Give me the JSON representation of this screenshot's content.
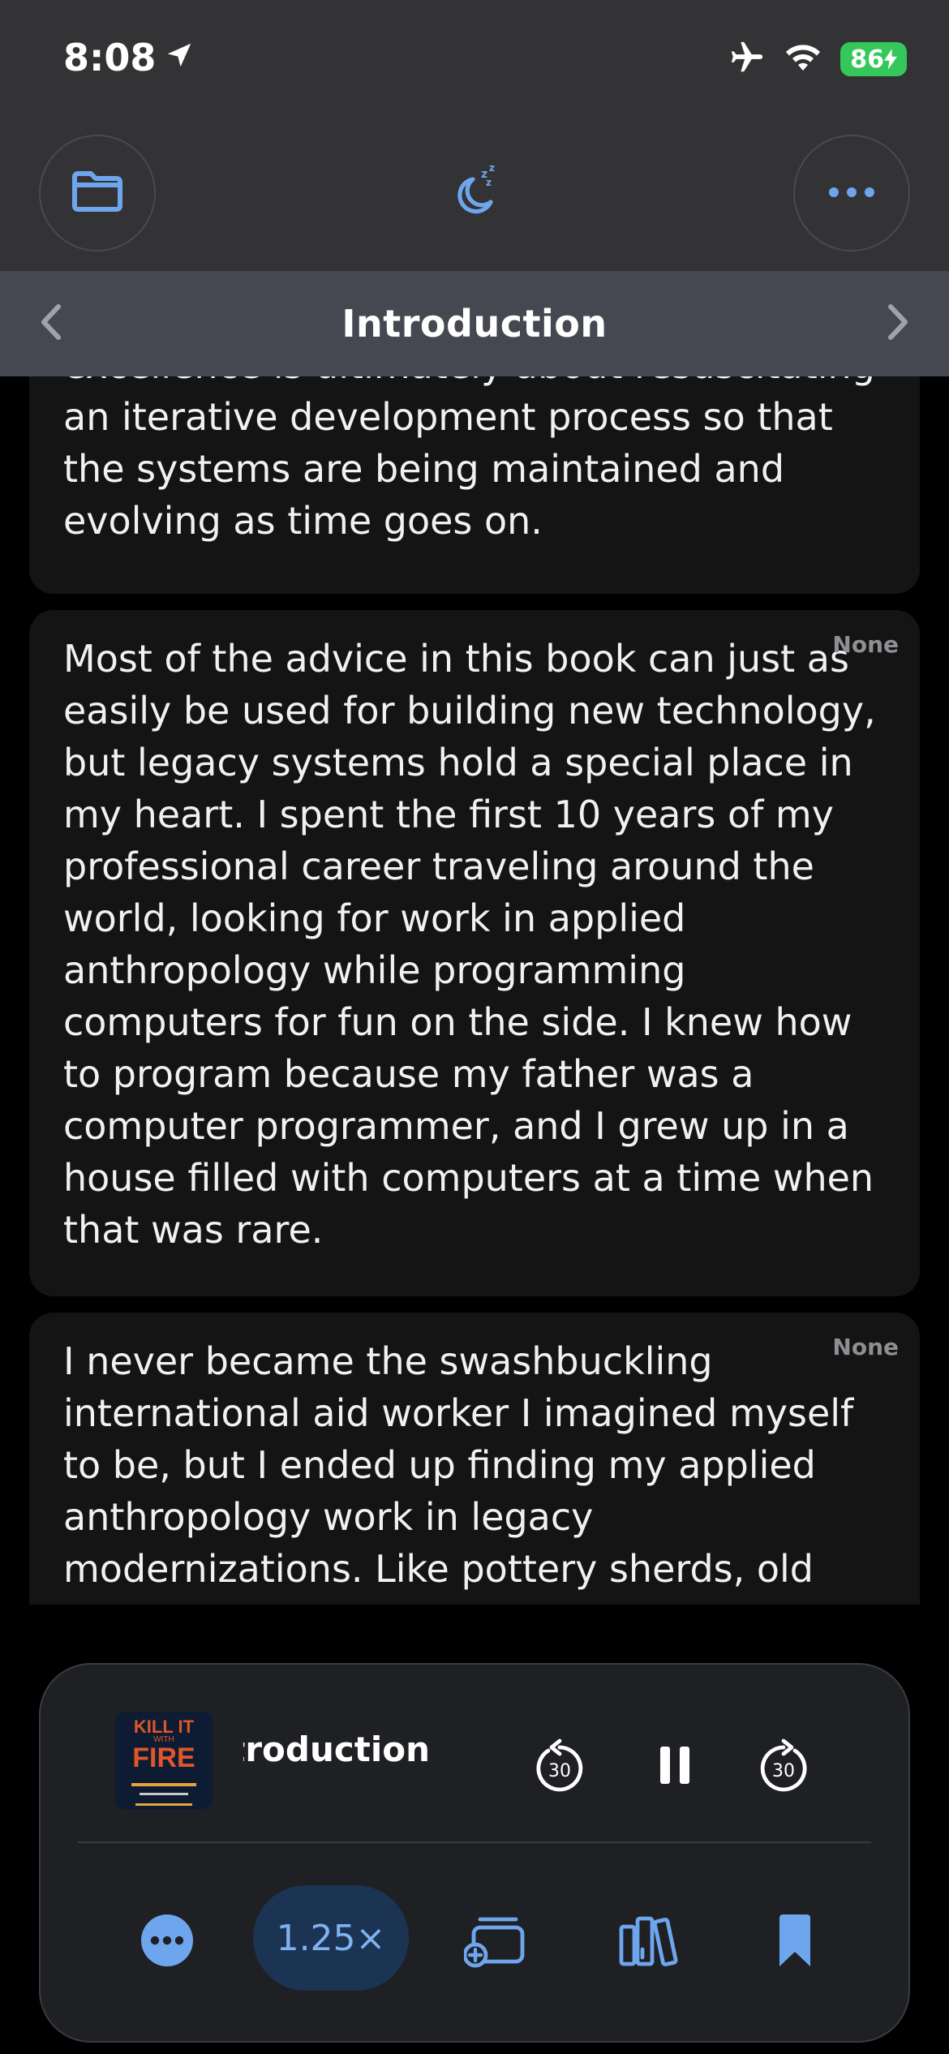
{
  "status": {
    "time": "8:08",
    "battery": "86"
  },
  "chapter": {
    "title": "Introduction"
  },
  "cards": [
    {
      "tag": "",
      "text": "excellence is ultimately about resuscitating an iterative development process so that the systems are being maintained and evolving as time goes on."
    },
    {
      "tag": "None",
      "text": "Most of the advice in this book can just as easily be used for building new technology, but legacy systems hold a special place in my heart. I spent the first 10 years of my professional career traveling around the world, looking for work in applied anthropology while programming computers for fun on the side. I knew how to program because my father was a computer programmer, and I grew up in a house filled with computers at a time when that was rare."
    },
    {
      "tag": "None",
      "text": "I never became the swashbuckling international aid worker I imagined myself to be, but I ended up finding my applied anthropology work in legacy modernizations. Like pottery sherds, old"
    }
  ],
  "player": {
    "track_title": "Introduction",
    "cover_line1": "KILL IT",
    "cover_line2": "WITH",
    "cover_line3": "FIRE",
    "skip_back": "30",
    "skip_forward": "30",
    "speed": "1.25×"
  },
  "colors": {
    "accent": "#6ea6ee",
    "battery": "#34c759"
  }
}
